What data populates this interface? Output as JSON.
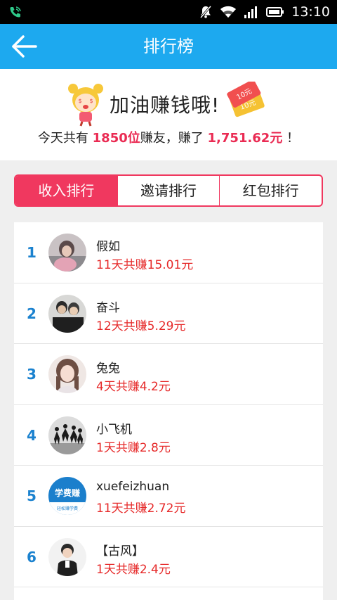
{
  "status_bar": {
    "time": "13:10"
  },
  "app_bar": {
    "title": "排行榜"
  },
  "summary": {
    "headline": "加油赚钱哦!",
    "line_prefix": "今天共有",
    "user_count": "1850位",
    "line_mid": "赚友，赚了",
    "total_amount": "1,751.62元",
    "line_suffix": "！",
    "coupon_text": "10元"
  },
  "tabs": [
    {
      "label": "收入排行",
      "active": true
    },
    {
      "label": "邀请排行",
      "active": false
    },
    {
      "label": "红包排行",
      "active": false
    }
  ],
  "colors": {
    "primary": "#1da9ef",
    "accent": "#f0385f",
    "rank": "#1b82cf",
    "earn": "#e62929"
  },
  "ranking": [
    {
      "rank": "1",
      "name": "假如",
      "earned": "11天共赚15.01元"
    },
    {
      "rank": "2",
      "name": "奋斗",
      "earned": "12天共赚5.29元"
    },
    {
      "rank": "3",
      "name": "兔兔",
      "earned": "4天共赚4.2元"
    },
    {
      "rank": "4",
      "name": "小飞机",
      "earned": "1天共赚2.8元"
    },
    {
      "rank": "5",
      "name": "xuefeizhuan",
      "earned": "11天共赚2.72元",
      "avatar_text": "学费赚",
      "avatar_subtext": "轻松赚学费"
    },
    {
      "rank": "6",
      "name": "【古风】",
      "earned": "1天共赚2.4元"
    }
  ]
}
